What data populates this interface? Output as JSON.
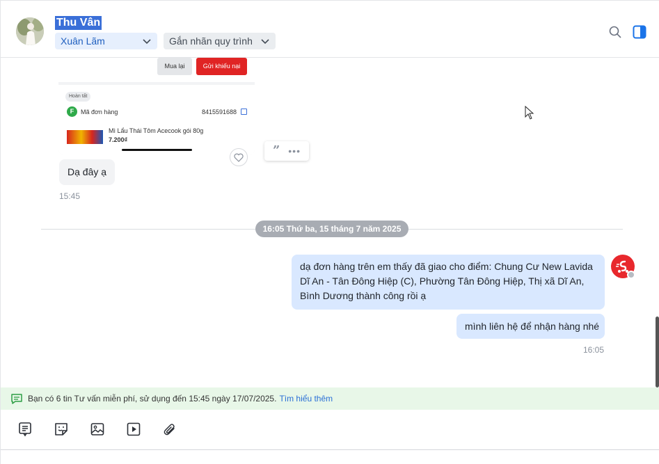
{
  "header": {
    "contact_name": "Thu Vân",
    "owner_tag": "Xuân Lãm",
    "flow_tag": "Gắn nhãn quy trình"
  },
  "shot": {
    "btn_rebuy": "Mua lại",
    "btn_complaint": "Gửi khiếu nại",
    "status": "Hoàn tất",
    "order_label": "Mã đơn hàng",
    "order_no": "8415591688",
    "product_name": "Mì Lẩu Thái Tôm Acecook gói 80g",
    "product_price": "7.200₫"
  },
  "messages": {
    "incoming_text": "Dạ đây ạ",
    "incoming_time": "15:45",
    "date_separator": "16:05 Thứ ba, 15 tháng 7 năm 2025",
    "outgoing_1": "dạ đơn hàng trên em thấy đã giao cho điểm: Chung Cư New Lavida Dĩ An - Tân Đông Hiệp (C), Phường Tân Đông Hiệp, Thị xã Dĩ An, Bình Dương thành công rồi ạ",
    "outgoing_2": "mình liên hệ để nhận hàng nhé",
    "outgoing_time": "16:05"
  },
  "notice": {
    "text": "Bạn có 6 tin Tư vấn miễn phí, sử dụng đến 15:45 ngày 17/07/2025.",
    "link": "Tìm hiểu thêm"
  },
  "toolbar": {
    "icons": [
      "quick-reply-icon",
      "sticker-icon",
      "image-icon",
      "video-icon",
      "attachment-icon"
    ]
  },
  "colors": {
    "accent": "#3a6fd8",
    "outgoing_bubble": "#d9e8ff",
    "incoming_bubble": "#f2f3f5",
    "notice_bg": "#e8f7e8",
    "brand_red": "#e8282d"
  }
}
